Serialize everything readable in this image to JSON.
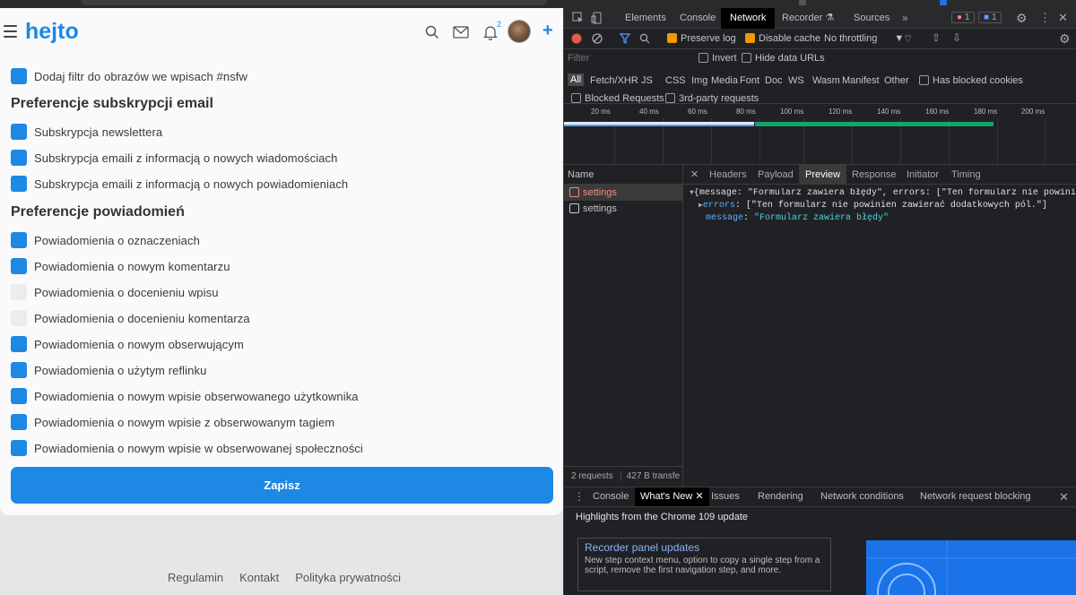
{
  "colors": {
    "accent": "#1e88e5",
    "devtools_bg": "#202124",
    "error": "#f28b82",
    "string": "#4dd0e1"
  },
  "header": {
    "logo": "hejto",
    "notification_count": "2"
  },
  "top_item": "Dodaj filtr do obrazów we wpisach #nsfw",
  "email_section": {
    "title": "Preferencje subskrypcji email",
    "items": [
      {
        "label": "Subskrypcja newslettera",
        "checked": true
      },
      {
        "label": "Subskrypcja emaili z informacją o nowych wiadomościach",
        "checked": true
      },
      {
        "label": "Subskrypcja emaili z informacją o nowych powiadomieniach",
        "checked": true
      }
    ]
  },
  "notif_section": {
    "title": "Preferencje powiadomień",
    "items": [
      {
        "label": "Powiadomienia o oznaczeniach",
        "checked": true
      },
      {
        "label": "Powiadomienia o nowym komentarzu",
        "checked": true
      },
      {
        "label": "Powiadomienia o docenieniu wpisu",
        "checked": false
      },
      {
        "label": "Powiadomienia o docenieniu komentarza",
        "checked": false
      },
      {
        "label": "Powiadomienia o nowym obserwującym",
        "checked": true
      },
      {
        "label": "Powiadomienia o użytym reflinku",
        "checked": true
      },
      {
        "label": "Powiadomienia o nowym wpisie obserwowanego użytkownika",
        "checked": true
      },
      {
        "label": "Powiadomienia o nowym wpisie z obserwowanym tagiem",
        "checked": true
      },
      {
        "label": "Powiadomienia o nowym wpisie w obserwowanej społeczności",
        "checked": true
      }
    ]
  },
  "save_label": "Zapisz",
  "footer": [
    "Regulamin",
    "Kontakt",
    "Polityka prywatności"
  ],
  "devtools": {
    "tabs": [
      "Elements",
      "Console",
      "Network",
      "Recorder",
      "Sources"
    ],
    "active_tab": "Network",
    "error_count": "1",
    "message_count": "1",
    "toolbar": {
      "preserve_log": "Preserve log",
      "disable_cache": "Disable cache",
      "throttling": "No throttling"
    },
    "filter": {
      "placeholder": "Filter",
      "invert": "Invert",
      "hide_data_urls": "Hide data URLs"
    },
    "type_filters": [
      "All",
      "Fetch/XHR",
      "JS",
      "CSS",
      "Img",
      "Media",
      "Font",
      "Doc",
      "WS",
      "Wasm",
      "Manifest",
      "Other"
    ],
    "blocked_cookies": "Has blocked cookies",
    "blocked_requests": "Blocked Requests",
    "third_party": "3rd-party requests",
    "timeline_ticks": [
      "20 ms",
      "40 ms",
      "60 ms",
      "80 ms",
      "100 ms",
      "120 ms",
      "140 ms",
      "160 ms",
      "180 ms",
      "200 ms"
    ],
    "name_header": "Name",
    "requests": [
      {
        "name": "settings",
        "error": true
      },
      {
        "name": "settings",
        "error": false
      }
    ],
    "detail_tabs": [
      "Headers",
      "Payload",
      "Preview",
      "Response",
      "Initiator",
      "Timing"
    ],
    "active_detail": "Preview",
    "preview": {
      "line1": "{message: \"Formularz zawiera błędy\", errors: [\"Ten formularz nie powinien zaw",
      "errors_key": "errors",
      "errors_val": "[\"Ten formularz nie powinien zawierać dodatkowych pól.\"]",
      "message_key": "message",
      "message_val": "\"Formularz zawiera błędy\""
    },
    "status": {
      "requests": "2 requests",
      "transferred": "427 B transfe"
    },
    "drawer_tabs": [
      "Console",
      "What's New",
      "Issues",
      "Rendering",
      "Network conditions",
      "Network request blocking"
    ],
    "drawer_active": "What's New",
    "highlights": "Highlights from the Chrome 109 update",
    "card_title": "Recorder panel updates",
    "card_text": "New step context menu, option to copy a single step from a script, remove the first navigation step, and more."
  }
}
